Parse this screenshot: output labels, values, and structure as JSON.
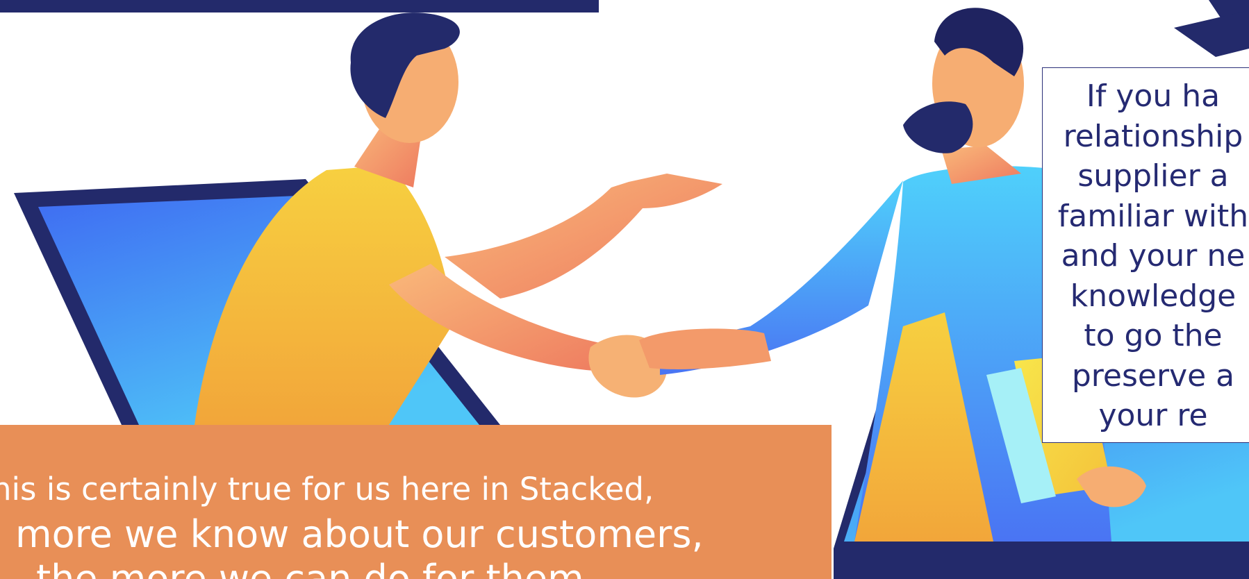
{
  "quote_box": {
    "lines": [
      "If you ha",
      "relationship",
      "supplier a",
      "familiar with",
      "and your ne",
      "knowledge",
      "to go the",
      "preserve a",
      "your re"
    ]
  },
  "orange_panel": {
    "line1": "his is certainly true for us here in Stacked,",
    "line2": "more we know about our customers,",
    "line3": "the more we can do for them"
  },
  "colors": {
    "navy": "#232a6b",
    "orange": "#e88f57",
    "laptop_blue": "#4a7bf5",
    "shirt_yellow": "#f2c230",
    "shirt_blue": "#4ab6f5",
    "skin": "#f4a570"
  },
  "icons": {
    "arrow": "down-arrow-icon",
    "left_figure": "man-in-laptop-illustration",
    "right_figure": "bearded-man-in-laptop-illustration"
  }
}
